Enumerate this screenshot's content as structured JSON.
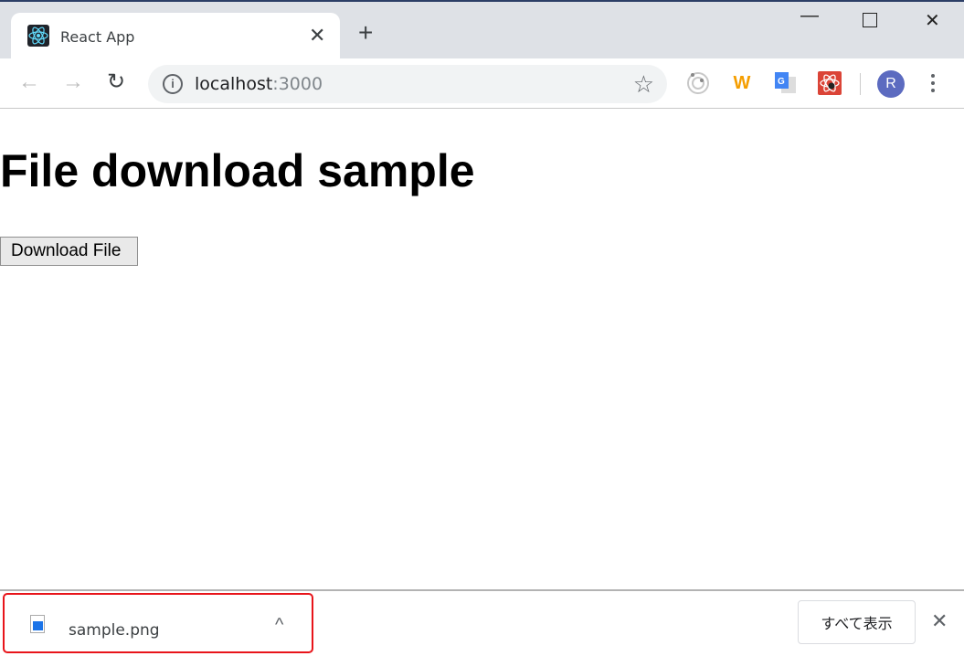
{
  "browser": {
    "tab_title": "React App",
    "url_host": "localhost",
    "url_port": ":3000",
    "avatar_letter": "R",
    "extensions": [
      "ring-extension-icon",
      "w-extension-icon",
      "google-translate-icon",
      "red-atom-extension-icon"
    ],
    "w_extension_letter": "W"
  },
  "page": {
    "heading": "File download sample",
    "download_button": "Download File"
  },
  "download_bar": {
    "file_name": "sample.png",
    "show_all": "すべて表示",
    "highlight_color": "#e8141a"
  }
}
